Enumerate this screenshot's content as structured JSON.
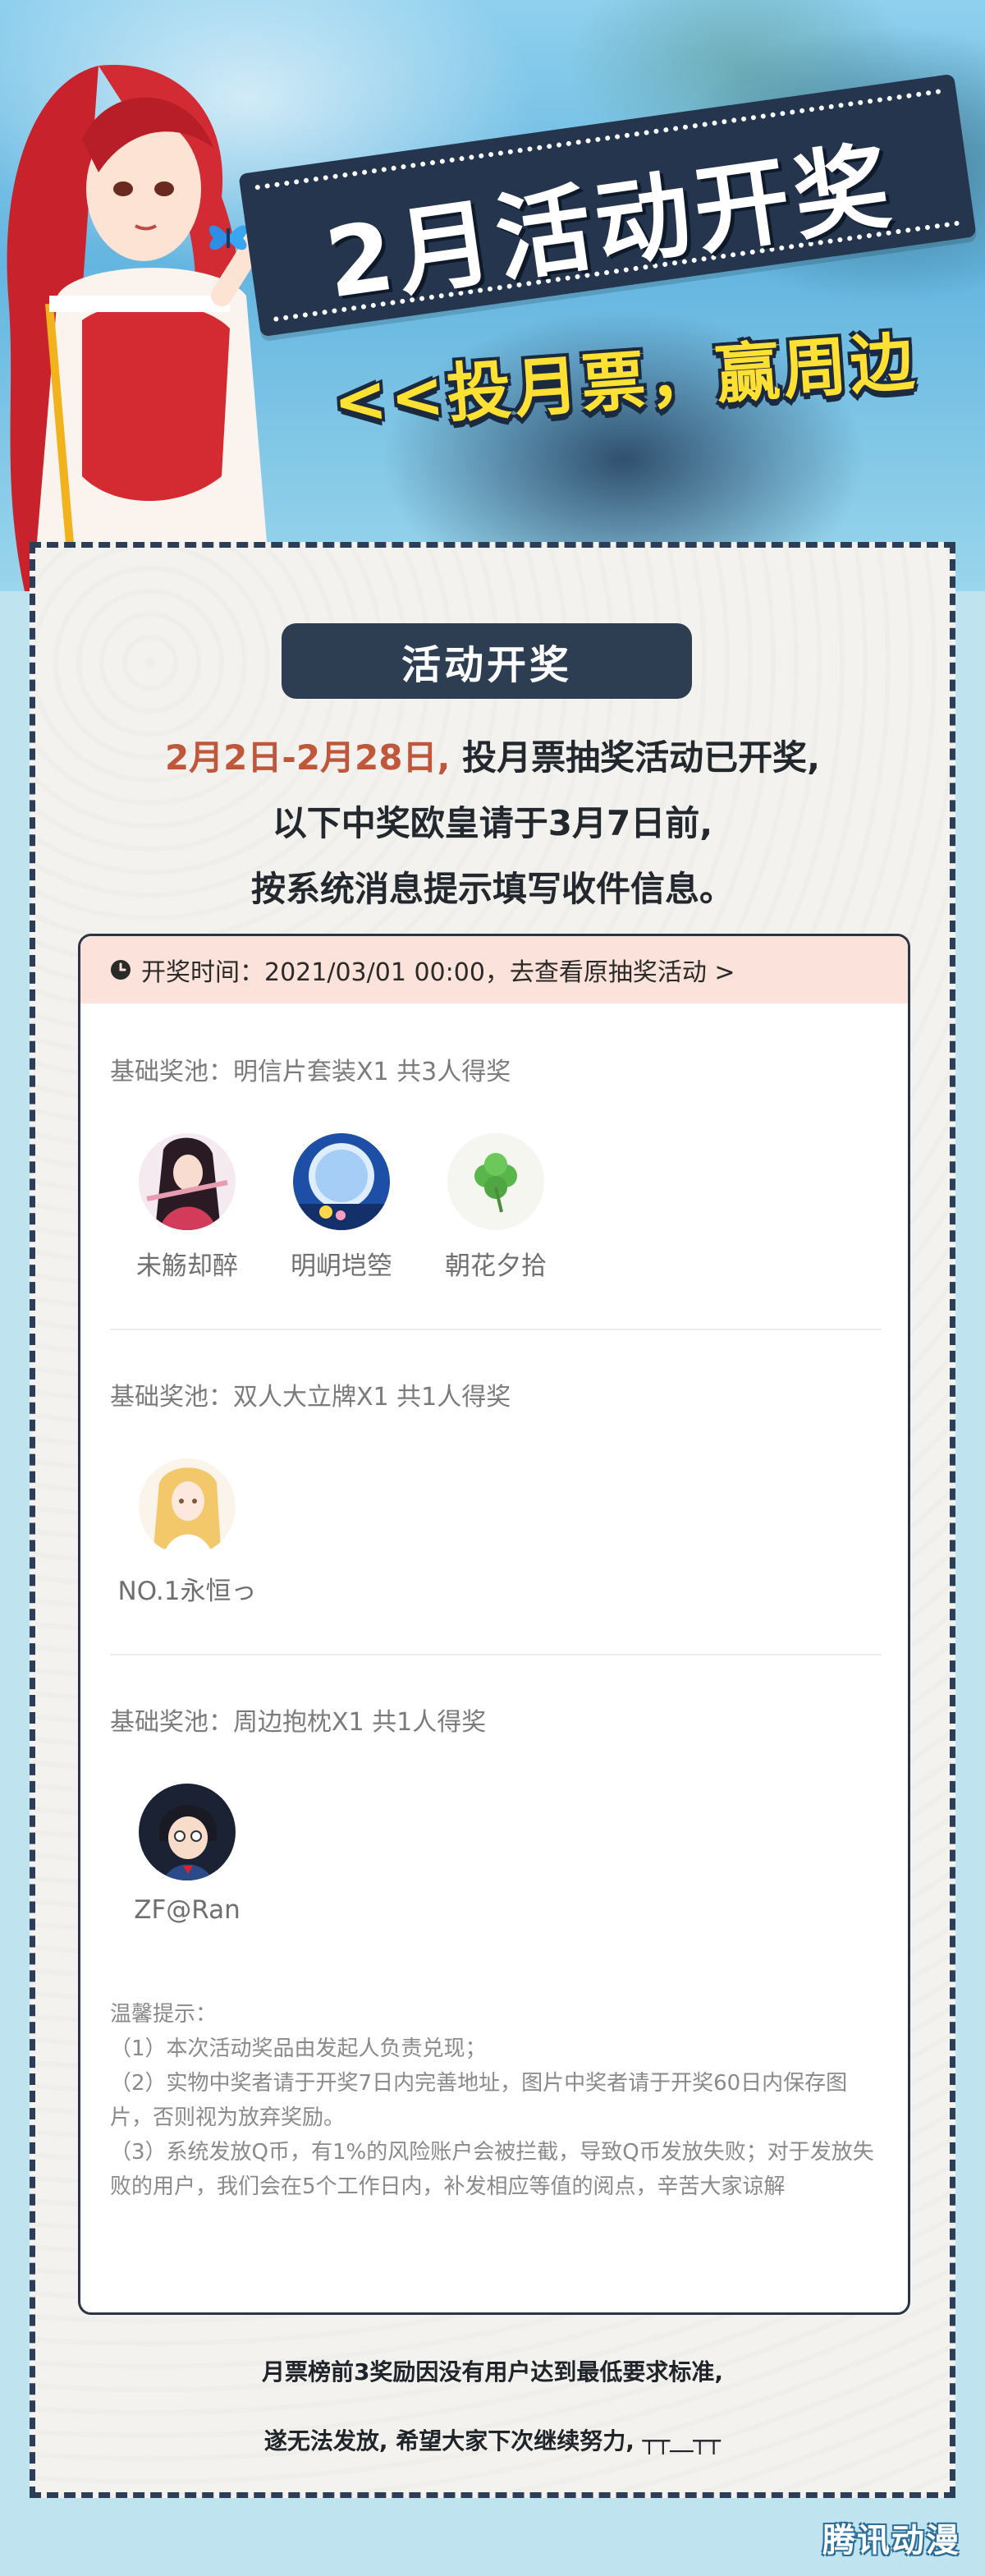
{
  "header": {
    "title": "2月活动开奖",
    "subtitle": "<<投月票，赢周边"
  },
  "card": {
    "section_label": "活动开奖",
    "intro": {
      "highlight": "2月2日-2月28日,",
      "line1_rest": "投月票抽奖活动已开奖,",
      "line2": "以下中奖欧皇请于3月7日前,",
      "line3": "按系统消息提示填写收件信息。"
    },
    "draw_time_label": "开奖时间：2021/03/01 00:00，去查看原抽奖活动 >",
    "pools": [
      {
        "title": "基础奖池：明信片套装X1 共3人得奖",
        "winners": [
          {
            "name": "未觞却醉"
          },
          {
            "name": "明岄垲箜"
          },
          {
            "name": "朝花夕拾"
          }
        ]
      },
      {
        "title": "基础奖池：双人大立牌X1 共1人得奖",
        "winners": [
          {
            "name": "NO.1永恒っ"
          }
        ]
      },
      {
        "title": "基础奖池：周边抱枕X1 共1人得奖",
        "winners": [
          {
            "name": "ZF@Ran"
          }
        ]
      }
    ],
    "tips": {
      "heading": "温馨提示：",
      "item1": "（1）本次活动奖品由发起人负责兑现；",
      "item2": "（2）实物中奖者请于开奖7日内完善地址，图片中奖者请于开奖60日内保存图片，否则视为放弃奖励。",
      "item3": "（3）系统发放Q币，有1%的风险账户会被拦截，导致Q币发放失败；对于发放失败的用户，我们会在5个工作日内，补发相应等值的阅点，辛苦大家谅解"
    },
    "footer_line1": "月票榜前3奖励因没有用户达到最低要求标准,",
    "footer_line2": "遂无法发放, 希望大家下次继续努力, ┬┬＿┬┬"
  },
  "watermark": "腾讯动漫",
  "colors": {
    "navy": "#2d3e53",
    "highlight": "#c0563a",
    "subtitle_yellow": "#ffe033",
    "panel_head": "#fbe2da"
  }
}
